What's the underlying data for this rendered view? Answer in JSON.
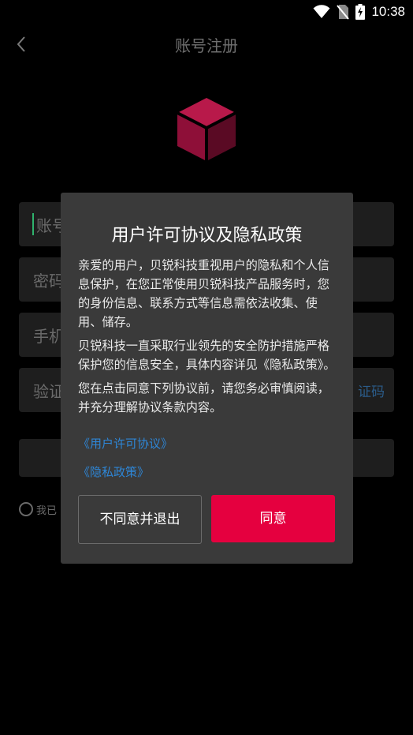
{
  "status_bar": {
    "time": "10:38",
    "icons": [
      "wifi-icon",
      "no-sim-icon",
      "battery-charging-icon"
    ]
  },
  "header": {
    "title": "账号注册",
    "back_icon": "chevron-left-icon"
  },
  "logo": {
    "icon": "cube-logo-icon",
    "colors": {
      "top": "#b8194a",
      "left": "#8e0f38",
      "right": "#5a0a24"
    }
  },
  "form": {
    "account_placeholder": "账号",
    "password_placeholder": "密码",
    "phone_placeholder": "手机",
    "code_placeholder": "验证",
    "get_code_label": "证码",
    "terms_prefix": "我已"
  },
  "dialog": {
    "title": "用户许可协议及隐私政策",
    "paragraphs": [
      "亲爱的用户，贝锐科技重视用户的隐私和个人信息保护，在您正常使用贝锐科技产品服务时，您的身份信息、联系方式等信息需依法收集、使用、储存。",
      "贝锐科技一直采取行业领先的安全防护措施严格保护您的信息安全，具体内容详见《隐私政策》。",
      "您在点击同意下列协议前，请您务必审慎阅读，并充分理解协议条款内容。"
    ],
    "links": [
      "《用户许可协议》",
      "《隐私政策》"
    ],
    "disagree_label": "不同意并退出",
    "agree_label": "同意"
  },
  "colors": {
    "accent": "#e5003f",
    "link": "#2e86d6",
    "dialog_bg": "#3a3a3a",
    "field_bg": "#1e1e1e"
  }
}
